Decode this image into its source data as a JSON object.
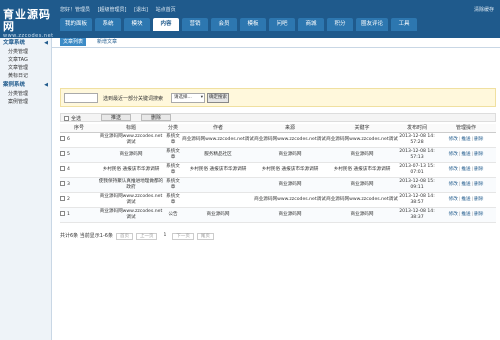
{
  "header": {
    "logo_title": "育业源码网",
    "logo_sub": "www.zzcodes.net",
    "user_links": [
      "您好！管理员",
      "[超级管理员]",
      "[退出]",
      "站点首页"
    ],
    "clear_cache": "清除缓存"
  },
  "nav": [
    "我的面板",
    "系统",
    "模块",
    "内容",
    "营销",
    "会员",
    "模板",
    "问吧",
    "商城",
    "积分",
    "圈友评论",
    "工具"
  ],
  "sidebar": {
    "sections": [
      {
        "title": "文章系统",
        "items": [
          "分类管理",
          "文章TAG",
          "文章管理",
          "黄标日记"
        ]
      },
      {
        "title": "案例系统",
        "items": [
          "分类管理",
          "案例管理"
        ]
      }
    ]
  },
  "subtabs": [
    "文章列表",
    "新增文章"
  ],
  "search": {
    "text": "选到最近一部分关键词搜索",
    "select_value": "请选择...",
    "button": "确定搜索"
  },
  "actions": {
    "select_all": "全选",
    "buttons": [
      "推送",
      "删除"
    ]
  },
  "table": {
    "headers": [
      "序号",
      "标题",
      "分类",
      "作者",
      "来源",
      "关键字",
      "发布时间",
      "管理操作"
    ],
    "rows": [
      {
        "id": "6",
        "title": "商业源码网www.zzcodes.net调试",
        "category": "系统文章",
        "author": "商业源码网www.zzcodes.net调试",
        "source": "商业源码网www.zzcodes.net调试",
        "keywords": "商业源码网www.zzcodes.net调试",
        "time": "2013-12-08 14:57:28"
      },
      {
        "id": "5",
        "title": "商业源码网",
        "category": "系统文章",
        "author": "服务精品社区",
        "source": "商业源码网",
        "keywords": "商业源码网",
        "time": "2013-12-08 14:57:13"
      },
      {
        "id": "4",
        "title": "乡村民俗 通报该市华源调研",
        "category": "系统文章",
        "author": "乡村民俗 通报该市华源调研",
        "source": "乡村民俗 通报该市华源调研",
        "keywords": "乡村民俗 通报该市华源调研",
        "time": "2013-07-13 15:07:01"
      },
      {
        "id": "3",
        "title": "使我保持聚认真推进地理做都的政府",
        "category": "系统文章",
        "author": "",
        "source": "商业源码网",
        "keywords": "商业源码网",
        "time": "2013-12-08 15:09:11"
      },
      {
        "id": "2",
        "title": "商业源码网www.zzcodes.net调试",
        "category": "系统文章",
        "author": "",
        "source": "商业源码网www.zzcodes.net调试",
        "keywords": "商业源码网www.zzcodes.net调试",
        "time": "2013-12-08 14:38:57"
      },
      {
        "id": "1",
        "title": "商业源码网www.zzcodes.net调试",
        "category": "公告",
        "author": "商业源码网",
        "source": "商业源码网",
        "keywords": "商业源码网",
        "time": "2013-12-08 14:38:37"
      }
    ],
    "ops": [
      "修改",
      "推送",
      "删除"
    ]
  },
  "pager": {
    "summary": "共计6条 当前显示1-6条",
    "first": "首页",
    "prev": "上一页",
    "current": "1",
    "next": "下一页",
    "last": "尾页"
  }
}
